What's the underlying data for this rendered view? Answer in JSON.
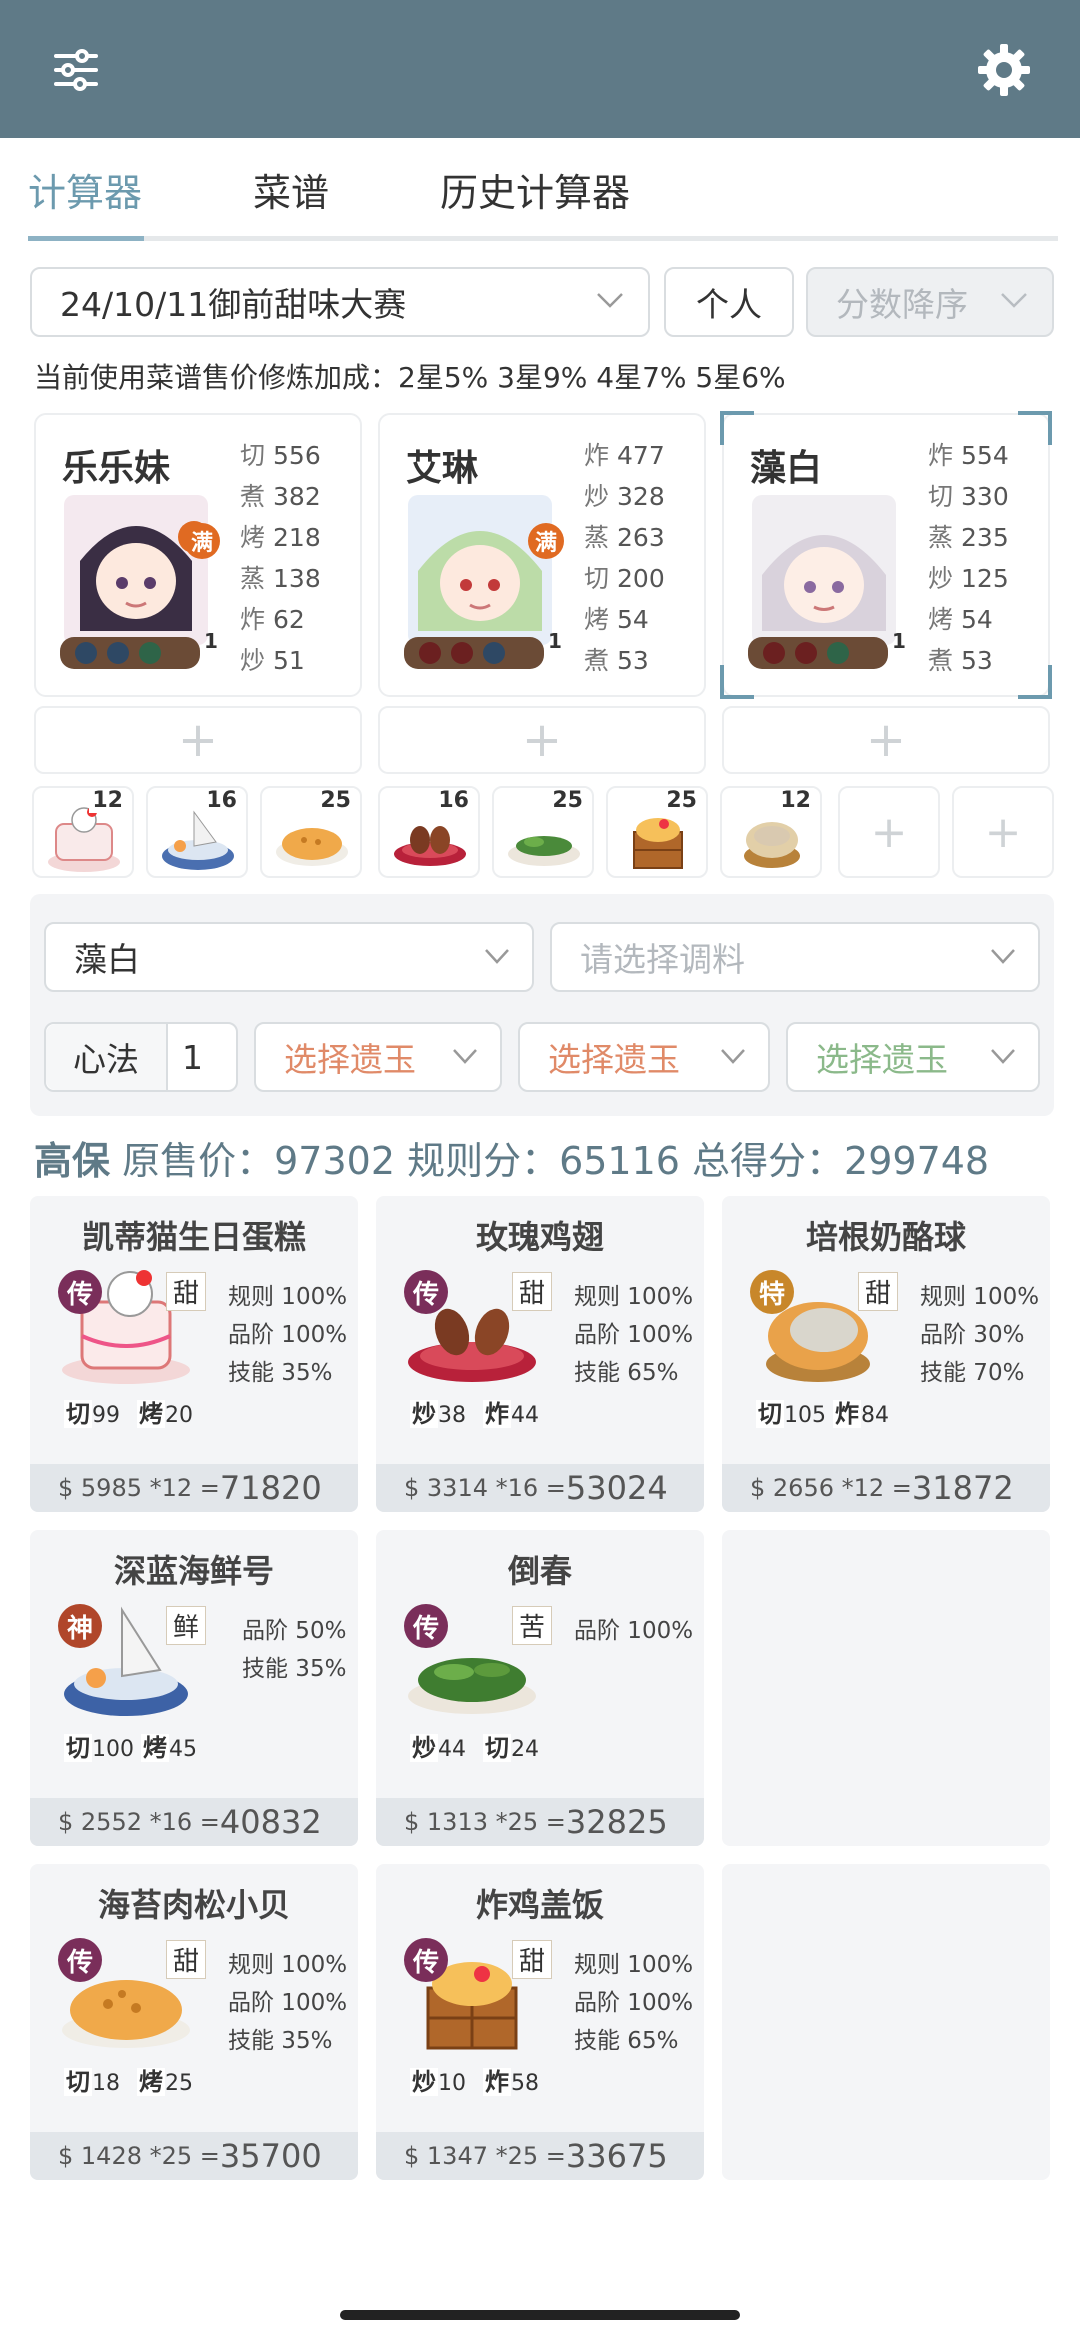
{
  "header": {
    "filter_icon": "sliders-icon",
    "settings_icon": "gear-icon"
  },
  "tabs": [
    {
      "label": "计算器",
      "active": true
    },
    {
      "label": "菜谱",
      "active": false
    },
    {
      "label": "历史计算器",
      "active": false
    }
  ],
  "filters": {
    "contest": "24/10/11御前甜味大赛",
    "mode": "个人",
    "sort": "分数降序"
  },
  "note": "当前使用菜谱售价修炼加成：2星5% 3星9% 4星7% 5星6%",
  "chefs": [
    {
      "name": "乐乐妹",
      "badge": "满",
      "level": "1",
      "skills": [
        {
          "k": "切",
          "v": "556"
        },
        {
          "k": "煮",
          "v": "382"
        },
        {
          "k": "烤",
          "v": "218"
        },
        {
          "k": "蒸",
          "v": "138"
        },
        {
          "k": "炸",
          "v": "62"
        },
        {
          "k": "炒",
          "v": "51"
        }
      ]
    },
    {
      "name": "艾琳",
      "badge": "满",
      "level": "1",
      "skills": [
        {
          "k": "炸",
          "v": "477"
        },
        {
          "k": "炒",
          "v": "328"
        },
        {
          "k": "蒸",
          "v": "263"
        },
        {
          "k": "切",
          "v": "200"
        },
        {
          "k": "烤",
          "v": "54"
        },
        {
          "k": "煮",
          "v": "53"
        }
      ]
    },
    {
      "name": "藻白",
      "badge": "",
      "level": "1",
      "skills": [
        {
          "k": "炸",
          "v": "554"
        },
        {
          "k": "切",
          "v": "330"
        },
        {
          "k": "蒸",
          "v": "235"
        },
        {
          "k": "炒",
          "v": "125"
        },
        {
          "k": "烤",
          "v": "54"
        },
        {
          "k": "煮",
          "v": "53"
        }
      ]
    }
  ],
  "add_symbol": "+",
  "dish_slots": [
    {
      "qty": "12",
      "icon": "cake-icon"
    },
    {
      "qty": "16",
      "icon": "seafood-boat-icon"
    },
    {
      "qty": "25",
      "icon": "pie-icon"
    },
    {
      "qty": "16",
      "icon": "chicken-wings-icon"
    },
    {
      "qty": "25",
      "icon": "greens-icon"
    },
    {
      "qty": "25",
      "icon": "rice-box-icon"
    },
    {
      "qty": "12",
      "icon": "cheese-ball-icon"
    }
  ],
  "panel": {
    "chef_select": "藻白",
    "seasoning_placeholder": "请选择调料",
    "xinfa_label": "心法",
    "xinfa_value": "1",
    "relic1": "选择遗玉",
    "relic2": "选择遗玉",
    "relic3": "选择遗玉"
  },
  "summary": {
    "label": "高保",
    "text": "原售价：97302 规则分：65116 总得分：299748"
  },
  "recipes": [
    {
      "title": "凯蒂猫生日蛋糕",
      "grade": "传",
      "taste": "甜",
      "stats": [
        "规则 100%",
        "品阶 100%",
        "技能 35%"
      ],
      "req": [
        {
          "k": "切",
          "v": "99"
        },
        {
          "k": "烤",
          "v": "20"
        }
      ],
      "price": "$ 5985 *12 = ",
      "total": "71820"
    },
    {
      "title": "玫瑰鸡翅",
      "grade": "传",
      "taste": "甜",
      "stats": [
        "规则 100%",
        "品阶 100%",
        "技能 65%"
      ],
      "req": [
        {
          "k": "炒",
          "v": "38"
        },
        {
          "k": "炸",
          "v": "44"
        }
      ],
      "price": "$ 3314 *16 = ",
      "total": "53024"
    },
    {
      "title": "培根奶酪球",
      "grade": "特",
      "taste": "甜",
      "stats": [
        "规则 100%",
        "品阶 30%",
        "技能 70%"
      ],
      "req": [
        {
          "k": "切",
          "v": "105"
        },
        {
          "k": "炸",
          "v": "84"
        }
      ],
      "price": "$ 2656 *12 = ",
      "total": "31872"
    },
    {
      "title": "深蓝海鲜号",
      "grade": "神",
      "taste": "鲜",
      "stats": [
        "品阶 50%",
        "技能 35%"
      ],
      "req": [
        {
          "k": "切",
          "v": "100"
        },
        {
          "k": "烤",
          "v": "45"
        }
      ],
      "price": "$ 2552 *16 = ",
      "total": "40832"
    },
    {
      "title": "倒春",
      "grade": "传",
      "taste": "苦",
      "stats": [
        "品阶 100%"
      ],
      "req": [
        {
          "k": "炒",
          "v": "44"
        },
        {
          "k": "切",
          "v": "24"
        }
      ],
      "price": "$ 1313 *25 = ",
      "total": "32825"
    },
    {
      "title": "海苔肉松小贝",
      "grade": "传",
      "taste": "甜",
      "stats": [
        "规则 100%",
        "品阶 100%",
        "技能 35%"
      ],
      "req": [
        {
          "k": "切",
          "v": "18"
        },
        {
          "k": "烤",
          "v": "25"
        }
      ],
      "price": "$ 1428 *25 = ",
      "total": "35700"
    },
    {
      "title": "炸鸡盖饭",
      "grade": "传",
      "taste": "甜",
      "stats": [
        "规则 100%",
        "品阶 100%",
        "技能 65%"
      ],
      "req": [
        {
          "k": "炒",
          "v": "10"
        },
        {
          "k": "炸",
          "v": "58"
        }
      ],
      "price": "$ 1347 *25 = ",
      "total": "33675"
    }
  ],
  "colors": {
    "header": "#5f7a87",
    "accent": "#6c9aae",
    "grade_legend": "#7a2e5a",
    "grade_special": "#c8872a",
    "grade_god": "#b0462a",
    "relic_orange": "#e08a68",
    "relic_green": "#8bb98a"
  }
}
